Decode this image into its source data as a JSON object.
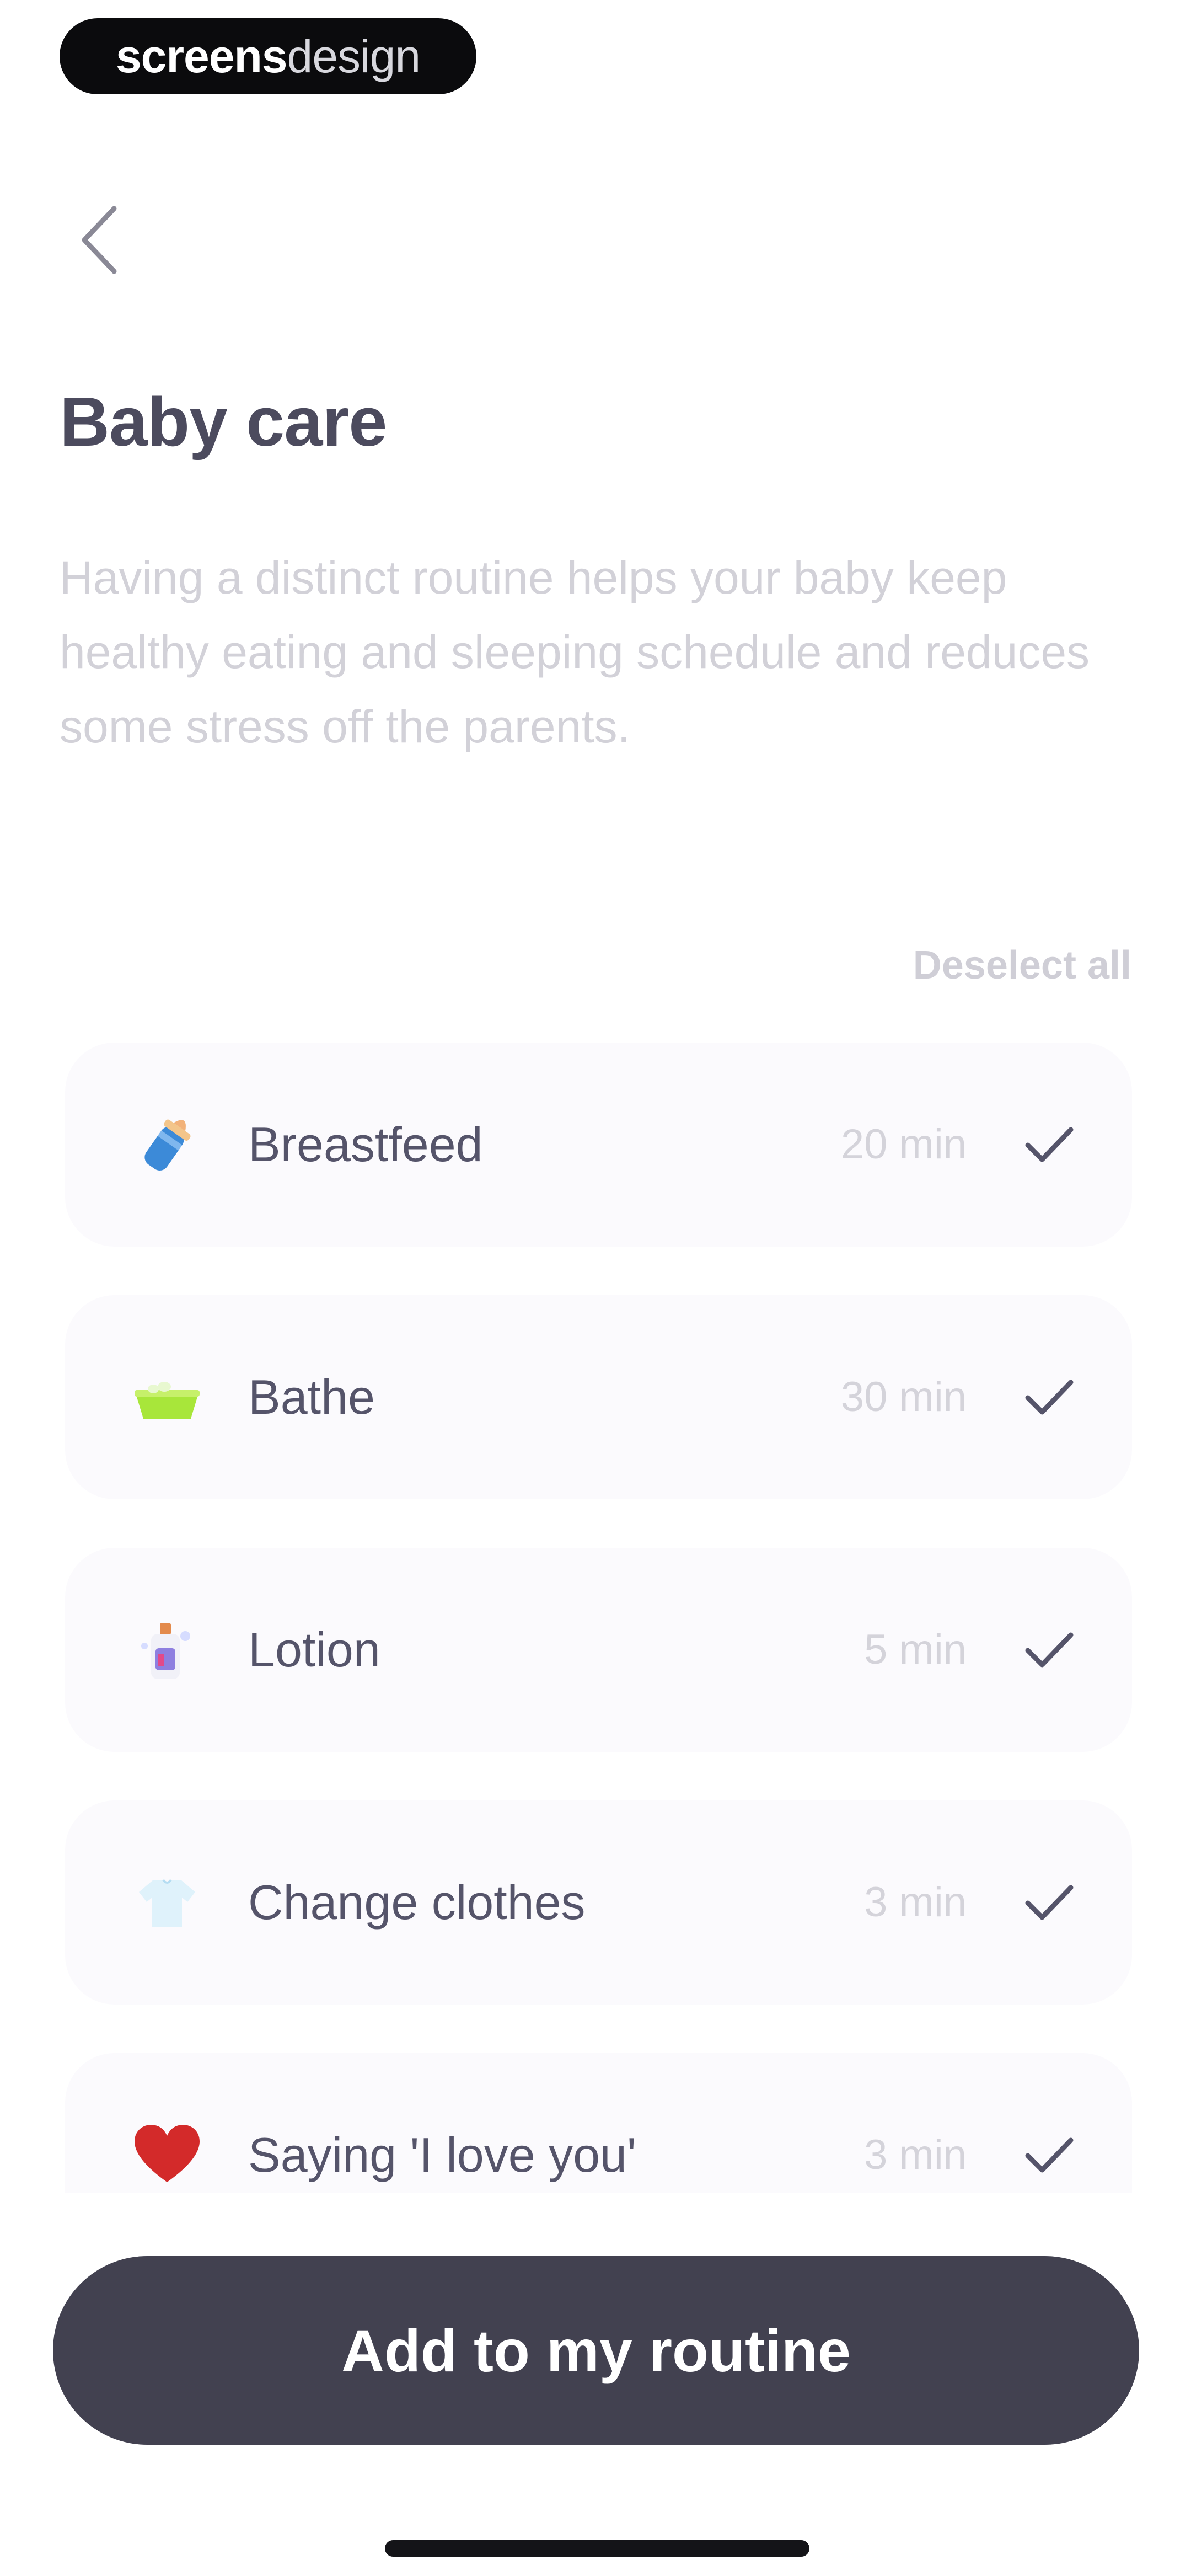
{
  "watermark": {
    "bold": "screens",
    "light": "design"
  },
  "header": {
    "back_icon": "chevron-left-icon",
    "title": "Baby care",
    "description": "Having a distinct routine helps your baby keep healthy eating and sleeping schedule and reduces some stress off the parents."
  },
  "list": {
    "deselect_label": "Deselect all",
    "items": [
      {
        "label": "Breastfeed",
        "duration": "20 min",
        "icon": "baby-bottle-icon",
        "selected": true
      },
      {
        "label": "Bathe",
        "duration": "30 min",
        "icon": "bathtub-icon",
        "selected": true
      },
      {
        "label": "Lotion",
        "duration": "5 min",
        "icon": "lotion-bottle-icon",
        "selected": true
      },
      {
        "label": "Change clothes",
        "duration": "3 min",
        "icon": "shirt-icon",
        "selected": true
      },
      {
        "label": "Saying 'I love you'",
        "duration": "3 min",
        "icon": "heart-icon",
        "selected": true
      }
    ]
  },
  "footer": {
    "add_label": "Add to my routine"
  },
  "colors": {
    "primary": "#424150",
    "title": "#4c4b5e",
    "muted": "#d2d1d8",
    "card": "#fbfafd",
    "heart": "#d32a2a",
    "bath_green": "#a8e63a",
    "bottle_blue": "#3c8ad8"
  }
}
